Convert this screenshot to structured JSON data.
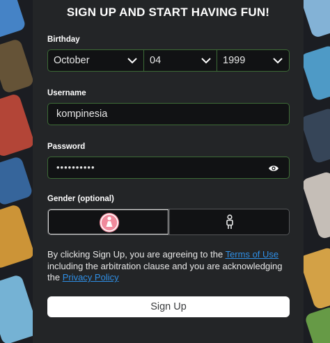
{
  "form": {
    "title": "SIGN UP AND START HAVING FUN!",
    "birthday": {
      "label": "Birthday",
      "month": "October",
      "day": "04",
      "year": "1999"
    },
    "username": {
      "label": "Username",
      "value": "kompinesia"
    },
    "password": {
      "label": "Password",
      "masked_value": "••••••••••"
    },
    "gender": {
      "label": "Gender (optional)",
      "options": [
        "female",
        "male"
      ],
      "selected": "female"
    },
    "legal": {
      "text_1": "By clicking Sign Up, you are agreeing to the ",
      "terms_link": "Terms of Use",
      "text_2": " including the arbitration clause and you are acknowledging the ",
      "privacy_link": "Privacy Policy"
    },
    "signup_button": "Sign Up"
  },
  "colors": {
    "panel_bg": "#232527",
    "field_border": "#3d6b36",
    "link": "#2f8fe6",
    "female_accent": "#f08a9c"
  }
}
